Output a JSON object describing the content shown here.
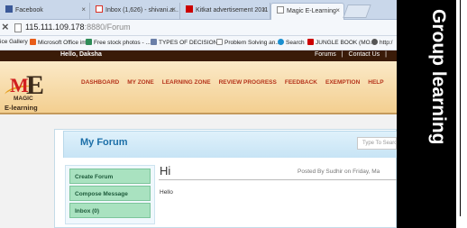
{
  "browser": {
    "tabs": [
      {
        "label": "Facebook",
        "icon": "facebook-icon",
        "color": "#3b5998"
      },
      {
        "label": "Inbox (1,626) - shivani.a...",
        "icon": "gmail-icon",
        "color": "#d93025"
      },
      {
        "label": "Kitkat advertisement 2011",
        "icon": "youtube-icon",
        "color": "#cc0000"
      },
      {
        "label": "Magic E-Learning",
        "icon": "page-icon",
        "color": "#ffffff"
      }
    ],
    "url_host": "115.111.109.178",
    "url_path": ":8880/Forum",
    "bookmarks": [
      {
        "label": "ice Gallery",
        "icon": "",
        "color": ""
      },
      {
        "label": "Microsoft Office im...",
        "icon": "office-icon",
        "color": "#e85d1a"
      },
      {
        "label": "Free stock photos - ...",
        "icon": "leaf-icon",
        "color": "#2e8b57"
      },
      {
        "label": "TYPES OF DECISION...",
        "icon": "doc-icon",
        "color": "#6b7fa8"
      },
      {
        "label": "Problem Solving an...",
        "icon": "page-icon",
        "color": "#ffffff"
      },
      {
        "label": "Search",
        "icon": "search-circle-icon",
        "color": "#1a8fd0"
      },
      {
        "label": "JUNGLE BOOK (MO...",
        "icon": "youtube-icon",
        "color": "#cc0000"
      },
      {
        "label": "http:/",
        "icon": "globe-icon",
        "color": "#555555"
      }
    ]
  },
  "site": {
    "hello": "Hello, Daksha",
    "toplinks": [
      "Forums",
      "|",
      "Contact Us",
      "|"
    ],
    "logo": {
      "m": "M",
      "e": "E",
      "magic": "MAGIC",
      "elearning": "E-learning"
    },
    "nav": [
      "DASHBOARD",
      "MY ZONE",
      "LEARNING ZONE",
      "REVIEW PROGRESS",
      "FEEDBACK",
      "EXEMPTION",
      "HELP"
    ],
    "forum_title": "My Forum",
    "search_placeholder": "Type To Search",
    "menu": [
      "Create Forum",
      "Compose Message",
      "Inbox (0)"
    ],
    "post": {
      "title": "Hi",
      "meta": "Posted By Sudhir on Friday, Ma",
      "body": "Hello"
    }
  },
  "caption": "Group learning",
  "colors": {
    "nav_red": "#b5341b",
    "forum_blue": "#1c6fa8",
    "menu_green": "#a9e2c0",
    "topbar_brown": "#3a1b08"
  }
}
